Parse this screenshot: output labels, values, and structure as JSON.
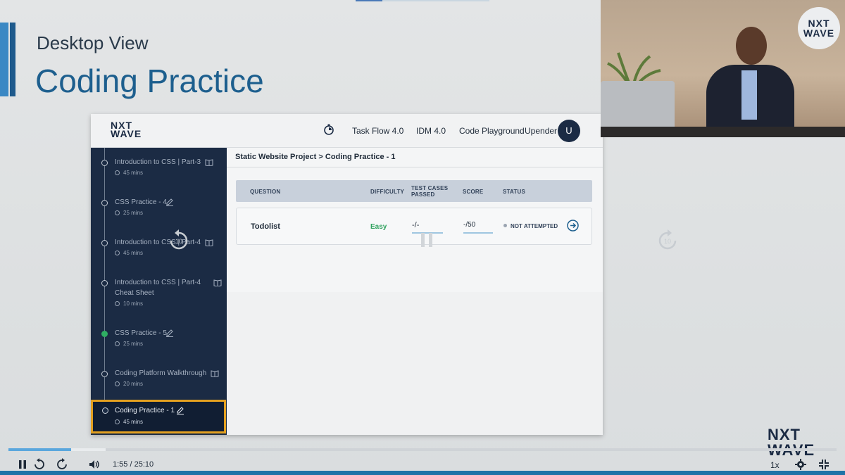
{
  "slide": {
    "subtitle": "Desktop View",
    "title": "Coding Practice"
  },
  "app": {
    "logo_line1": "NXT",
    "logo_line2": "WAVE",
    "nav": [
      "Task Flow 4.0",
      "IDM 4.0",
      "Code Playground",
      "Upender"
    ],
    "avatar_initial": "U",
    "breadcrumb": "Static Website Project > Coding Practice - 1"
  },
  "sidebar": {
    "items": [
      {
        "title": "Introduction to CSS | Part-3",
        "duration": "45 mins",
        "icon": "book-icon",
        "status": "pending"
      },
      {
        "title": "CSS Practice - 4",
        "duration": "25 mins",
        "icon": "edit-icon",
        "status": "pending"
      },
      {
        "title": "Introduction to CSS | Part-4",
        "duration": "45 mins",
        "icon": "book-icon",
        "status": "pending"
      },
      {
        "title": "Introduction to CSS | Part-4 Cheat Sheet",
        "duration": "10 mins",
        "icon": "book-icon",
        "status": "pending"
      },
      {
        "title": "CSS Practice - 5",
        "duration": "25 mins",
        "icon": "edit-icon",
        "status": "completed"
      },
      {
        "title": "Coding Platform Walkthrough",
        "duration": "20 mins",
        "icon": "book-icon",
        "status": "pending"
      },
      {
        "title": "Coding Practice - 1",
        "duration": "45 mins",
        "icon": "edit-icon",
        "status": "active"
      }
    ]
  },
  "table": {
    "headers": [
      "QUESTION",
      "DIFFICULTY",
      "TEST CASES PASSED",
      "SCORE",
      "STATUS"
    ],
    "rows": [
      {
        "question": "Todolist",
        "difficulty": "Easy",
        "tests": "-/-",
        "score": "-/50",
        "status": "NOT ATTEMPTED"
      }
    ]
  },
  "player": {
    "current_time": "1:55",
    "separator": "/",
    "total_time": "25:10",
    "speed": "1x",
    "rewind_seconds": "10",
    "forward_seconds": "10",
    "progress_fraction": 0.076,
    "buffered_fraction": 0.117
  },
  "brand": {
    "circle_line1": "NXT",
    "circle_line2": "WAVE",
    "corner_line1": "NXT",
    "corner_line2": "WAVE"
  },
  "colors": {
    "title_blue": "#1d5f8e",
    "sidebar_navy": "#1b2b44",
    "active_border": "#e3a020",
    "easy_green": "#2fa25e",
    "progress_blue": "#5aa7dd"
  }
}
